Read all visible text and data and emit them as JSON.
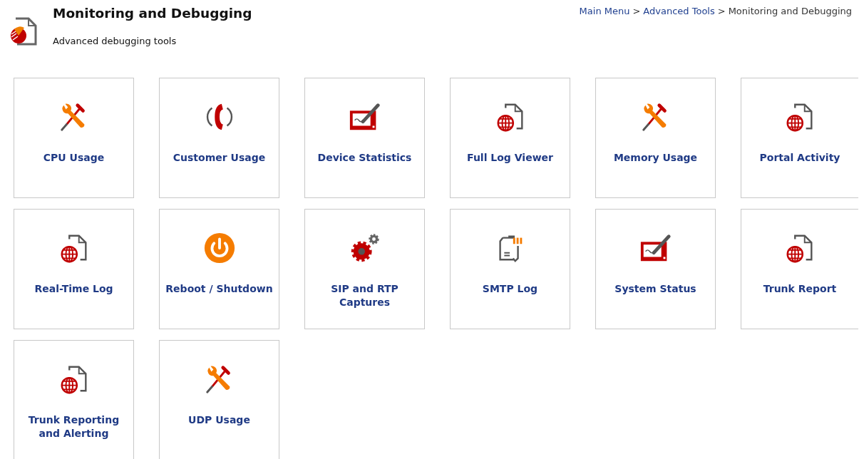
{
  "header": {
    "title": "Monitoring and Debugging",
    "subtitle": "Advanced debugging tools"
  },
  "breadcrumb": [
    {
      "label": "Main Menu",
      "current": false
    },
    {
      "label": ">",
      "kind": "separator"
    },
    {
      "label": "Advanced Tools",
      "current": false
    },
    {
      "label": ">",
      "kind": "separator"
    },
    {
      "label": "Monitoring and Debugging",
      "current": true
    }
  ],
  "tiles": [
    {
      "label": "CPU Usage",
      "kind": "tools"
    },
    {
      "label": "Customer Usage",
      "kind": "phone"
    },
    {
      "label": "Device Statistics",
      "kind": "tablet"
    },
    {
      "label": "Full Log Viewer",
      "kind": "globedoc"
    },
    {
      "label": "Memory Usage",
      "kind": "tools"
    },
    {
      "label": "Portal Activity",
      "kind": "globedoc"
    },
    {
      "label": "Real-Time Log",
      "kind": "globedoc"
    },
    {
      "label": "Reboot / Shutdown",
      "kind": "power"
    },
    {
      "label": "SIP and RTP Captures",
      "kind": "gears"
    },
    {
      "label": "SMTP Log",
      "kind": "logdoc"
    },
    {
      "label": "System Status",
      "kind": "tablet"
    },
    {
      "label": "Trunk Report",
      "kind": "globedoc"
    },
    {
      "label": "Trunk Reporting and Alerting",
      "kind": "globedoc"
    },
    {
      "label": "UDP Usage",
      "kind": "tools"
    }
  ]
}
